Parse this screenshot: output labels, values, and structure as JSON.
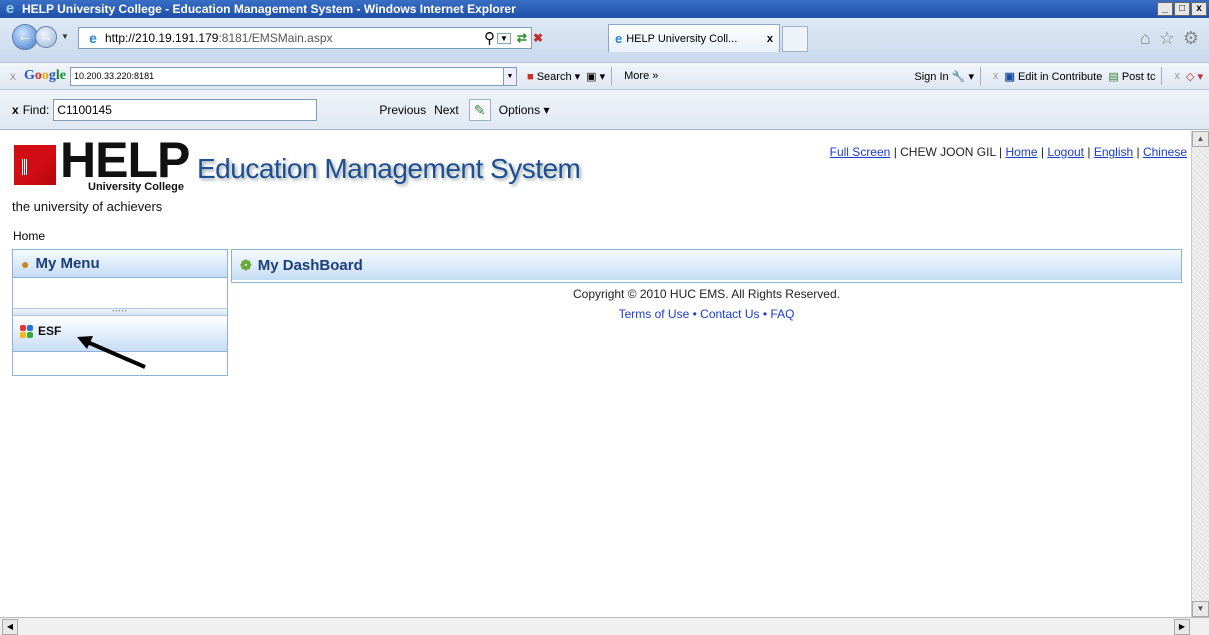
{
  "window": {
    "title": "HELP University College - Education Management System - Windows Internet Explorer",
    "buttons": [
      "_",
      "□",
      "x"
    ]
  },
  "address_bar": {
    "url_host": "http://210.19.191.179",
    "url_rest": ":8181/EMSMain.aspx",
    "tab_title": "HELP University Coll...",
    "tab_close": "x"
  },
  "google_toolbar": {
    "close": "x",
    "logo": [
      "G",
      "o",
      "o",
      "g",
      "le"
    ],
    "search_value": "10.200.33.220:8181",
    "search_label": "Search",
    "more_label": "More »",
    "sign_in_label": "Sign In",
    "edit_label": "Edit in Contribute",
    "post_label": "Post tc"
  },
  "find_bar": {
    "close": "x",
    "label": "Find:",
    "value": "C1100145",
    "previous": "Previous",
    "next": "Next",
    "options": "Options"
  },
  "header": {
    "logo_word": "HELP",
    "logo_sub": "University College",
    "tagline": "the university of achievers",
    "app_title": "Education Management System",
    "links": {
      "full_screen": "Full Screen",
      "user_name": "CHEW JOON GIL",
      "home": "Home",
      "logout": "Logout",
      "english": "English",
      "chinese": "Chinese"
    }
  },
  "breadcrumb": "Home",
  "menu": {
    "title": "My Menu",
    "items": [
      {
        "label": "ESF"
      }
    ]
  },
  "dashboard": {
    "title": "My DashBoard"
  },
  "footer": {
    "copyright": "Copyright © 2010 HUC EMS. All Rights Reserved.",
    "terms": "Terms of Use",
    "contact": "Contact Us",
    "faq": "FAQ"
  },
  "colors": {
    "title_bar": "#1d4fa6",
    "panel_header": "#c6dcf5",
    "link": "#1a3cc8",
    "brand_red": "#d10c14",
    "app_title": "#1f4e93"
  }
}
